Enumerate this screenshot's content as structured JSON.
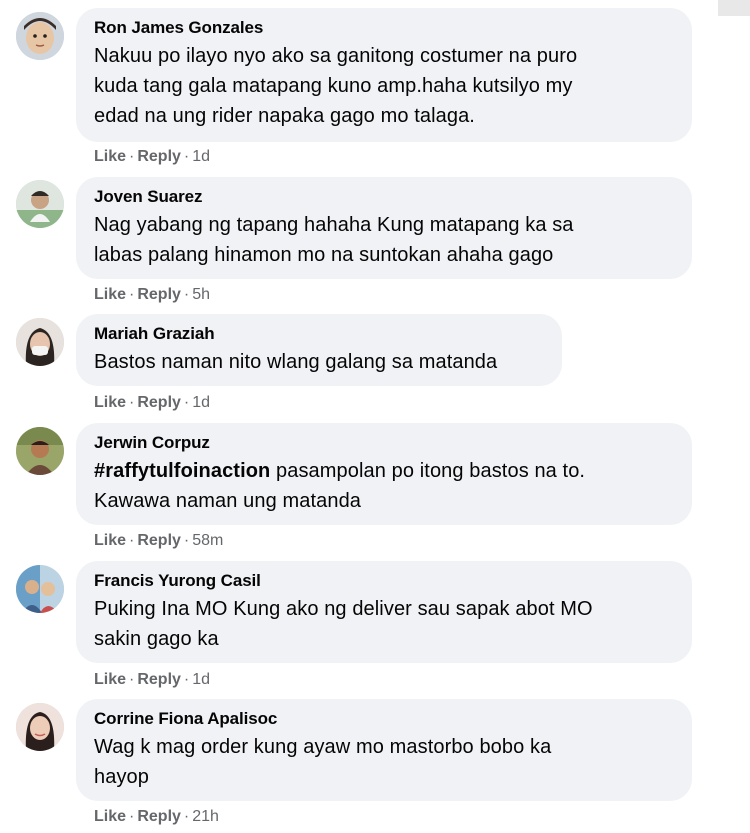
{
  "comments": [
    {
      "author": "Ron James Gonzales",
      "lines": [
        "Nakuu po ilayo nyo ako sa ganitong costumer na puro",
        "kuda tang gala matapang kuno amp.haha kutsilyo my",
        "edad na ung rider napaka gago mo talaga."
      ],
      "like": "Like",
      "reply": "Reply",
      "time": "1d",
      "avatar_colors": [
        "#e7c6a6",
        "#3b2e2a"
      ]
    },
    {
      "author": "Joven Suarez",
      "lines": [
        "Nag yabang ng tapang hahaha Kung matapang ka sa",
        "labas palang hinamon mo na suntokan ahaha gago"
      ],
      "like": "Like",
      "reply": "Reply",
      "time": "5h",
      "avatar_colors": [
        "#8fb58a",
        "#f3f3f3"
      ]
    },
    {
      "author": "Mariah Graziah",
      "lines": [
        "Bastos naman nito wlang galang sa matanda"
      ],
      "like": "Like",
      "reply": "Reply",
      "time": "1d",
      "avatar_colors": [
        "#d9cfc9",
        "#2b2421"
      ]
    },
    {
      "author": "Jerwin Corpuz",
      "hashtag": "#raffytulfoinaction",
      "lines": [
        " pasampolan po itong bastos na to.",
        "Kawawa naman ung matanda"
      ],
      "like": "Like",
      "reply": "Reply",
      "time": "58m",
      "avatar_colors": [
        "#7a8a4f",
        "#b57a52"
      ]
    },
    {
      "author": "Francis Yurong Casil",
      "lines": [
        "Puking Ina MO Kung ako ng deliver sau sapak abot MO",
        "sakin gago ka"
      ],
      "like": "Like",
      "reply": "Reply",
      "time": "1d",
      "avatar_colors": [
        "#6aa0c8",
        "#d9b08c"
      ]
    },
    {
      "author": "Corrine Fiona Apalisoc",
      "lines": [
        "Wag k mag order kung ayaw mo mastorbo bobo ka",
        "hayop"
      ],
      "like": "Like",
      "reply": "Reply",
      "time": "21h",
      "avatar_colors": [
        "#efe2dc",
        "#2a1f1c"
      ]
    }
  ]
}
